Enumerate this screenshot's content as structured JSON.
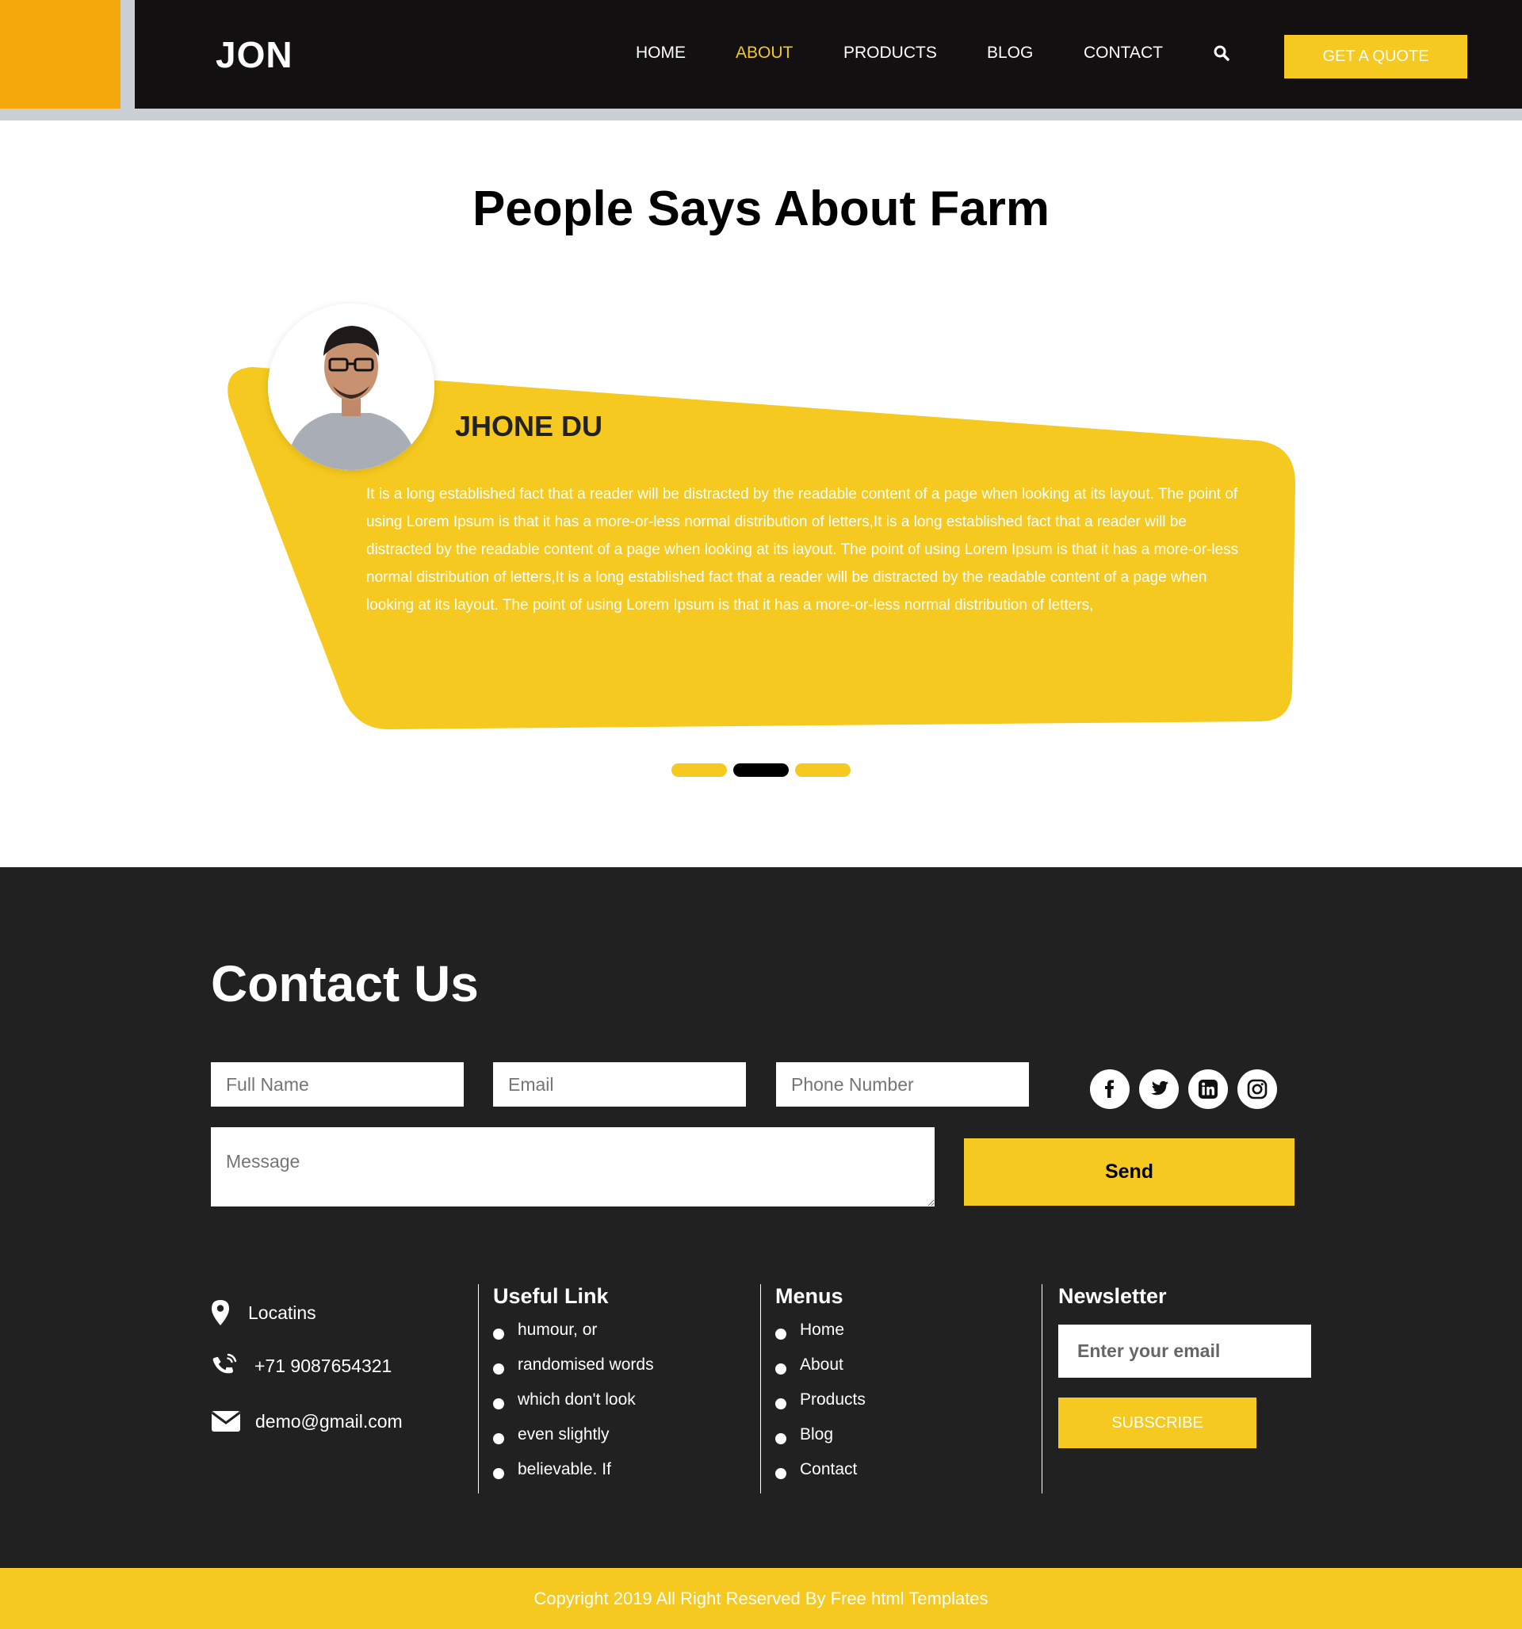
{
  "header": {
    "logo": "JON",
    "nav": [
      {
        "label": "HOME",
        "active": false
      },
      {
        "label": "ABOUT",
        "active": true
      },
      {
        "label": "PRODUCTS",
        "active": false
      },
      {
        "label": "BLOG",
        "active": false
      },
      {
        "label": "CONTACT",
        "active": false
      }
    ],
    "search_icon": "search-icon",
    "quote_button": "GET A QUOTE"
  },
  "testimonials": {
    "title": "People Says About Farm",
    "name": "JHONE DU",
    "text": "It is a long established fact that a reader will be distracted by the readable content of a page when looking at its layout. The point of using Lorem Ipsum is that it has a more-or-less normal distribution of letters,It is a long established fact that a reader will be distracted by the readable content of a page when looking at its layout. The point of using Lorem Ipsum is that it has a more-or-less normal distribution of letters,It is a long established fact that a reader will be distracted by the readable content of a page when looking at its layout. The point of using Lorem Ipsum is that it has a more-or-less normal distribution of letters,",
    "slides": 3,
    "active_slide": 2
  },
  "contact": {
    "title": "Contact Us",
    "full_name_placeholder": "Full Name",
    "email_placeholder": "Email",
    "phone_placeholder": "Phone Number",
    "message_placeholder": "Message",
    "send_label": "Send",
    "social": [
      "facebook-icon",
      "twitter-icon",
      "linkedin-icon",
      "instagram-icon"
    ]
  },
  "info": {
    "location": "Locatins",
    "phone": "+71 9087654321",
    "email": "demo@gmail.com"
  },
  "useful_links": {
    "title": "Useful Link",
    "items": [
      "humour, or",
      "randomised words",
      "which don't look",
      "even slightly",
      "believable. If"
    ]
  },
  "menus": {
    "title": "Menus",
    "items": [
      "Home",
      "About",
      "Products",
      "Blog",
      "Contact"
    ]
  },
  "newsletter": {
    "title": "Newsletter",
    "placeholder": "Enter your email",
    "button": "SUBSCRIBE"
  },
  "footer": {
    "copyright": "Copyright 2019 All Right Reserved By Free html Templates"
  },
  "colors": {
    "accent_yellow": "#f5c91f",
    "accent_orange": "#f4a80c",
    "dark": "#121010",
    "contact_bg": "#212121"
  }
}
